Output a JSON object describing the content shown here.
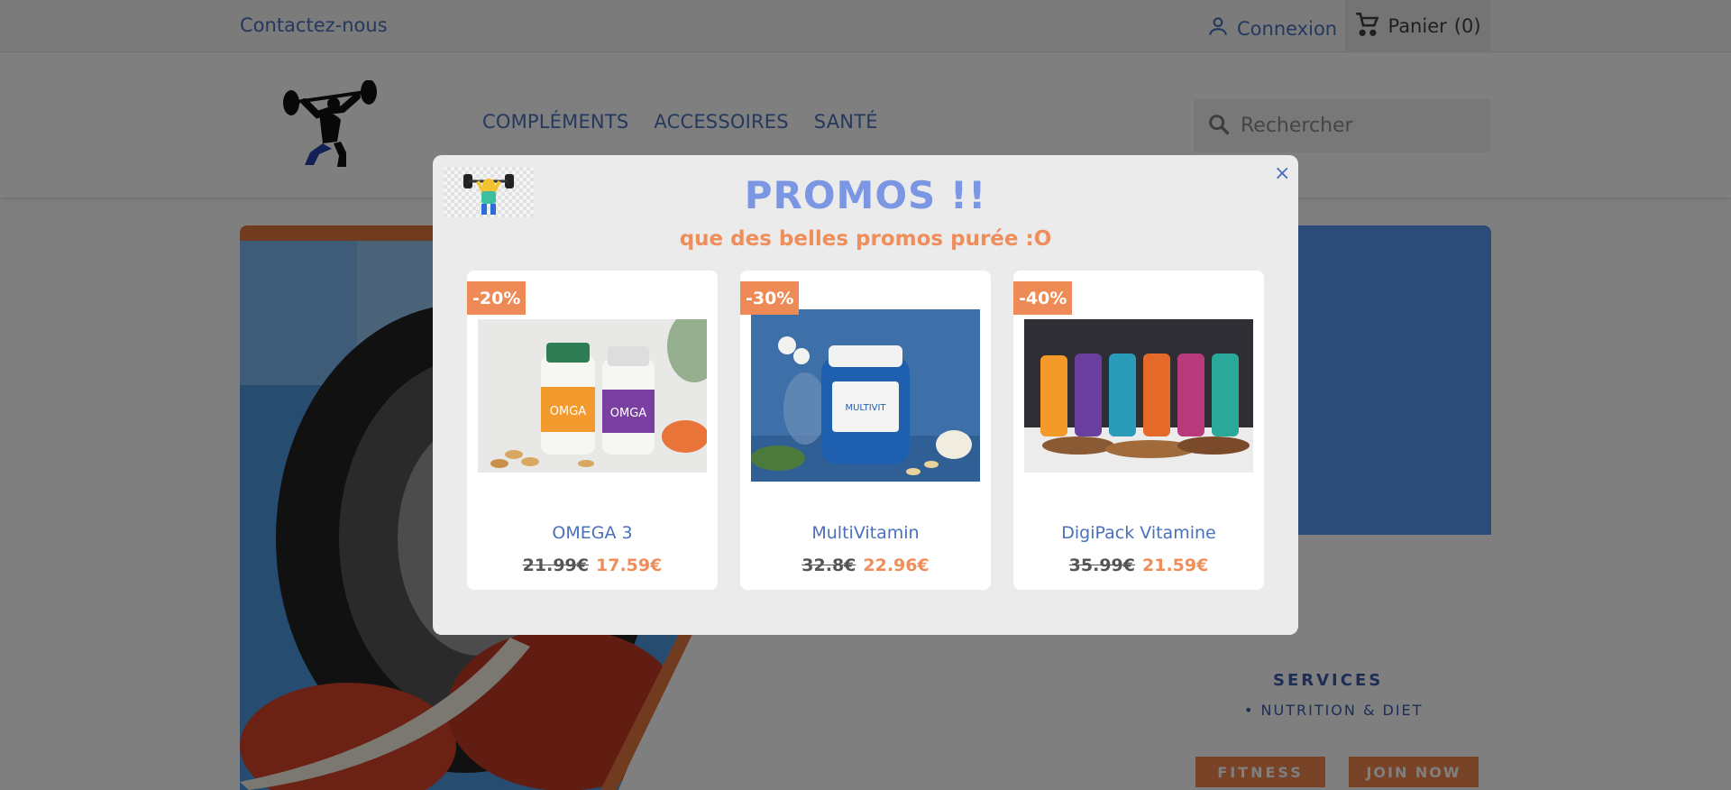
{
  "topbar": {
    "contact_label": "Contactez-nous",
    "login_label": "Connexion",
    "cart_label": "Panier",
    "cart_count": "(0)"
  },
  "header": {
    "nav": [
      "COMPLÉMENTS",
      "ACCESSOIRES",
      "SANTÉ"
    ],
    "search_placeholder": "Rechercher"
  },
  "hero": {
    "services_title": "SERVICES",
    "services_item": "• NUTRITION & DIET",
    "fitness_button": "FITNESS",
    "join_button": "JOIN NOW"
  },
  "modal": {
    "close_label": "×",
    "title": "PROMOS !!",
    "subtitle": "que des belles promos purée :O",
    "products": [
      {
        "name": "OMEGA 3",
        "discount": "-20%",
        "old_price": "21.99€",
        "new_price": "17.59€"
      },
      {
        "name": "MultiVitamin",
        "discount": "-30%",
        "old_price": "32.8€",
        "new_price": "22.96€"
      },
      {
        "name": "DigiPack Vitamine",
        "discount": "-40%",
        "old_price": "35.99€",
        "new_price": "21.59€"
      }
    ]
  },
  "colors": {
    "link_blue": "#4a70bb",
    "promo_orange": "#ef8e5a",
    "title_blue": "#7b97e3"
  }
}
